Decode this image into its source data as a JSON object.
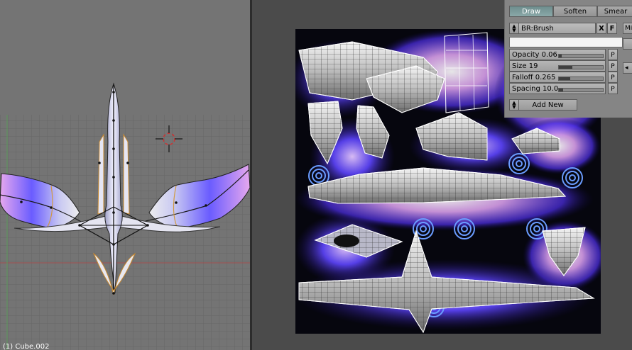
{
  "viewport": {
    "object_name": "(1) Cube.002",
    "colors": {
      "background": "#747474",
      "grid": "#666666",
      "axis_x": "#a05050",
      "axis_y": "#5a9a5a"
    }
  },
  "uv_editor": {
    "colors": {
      "background": "#4b4b4b",
      "texture_bg": "#06060e",
      "paint_blue": "#5a40ff",
      "paint_pink": "#e0a0ff",
      "wire": "#ffffff"
    }
  },
  "paint_panel": {
    "modes": [
      "Draw",
      "Soften",
      "Smear"
    ],
    "active_mode": "Draw",
    "brush_name": "BR:Brush",
    "brush_x_label": "X",
    "brush_f_label": "F",
    "brush_name_value": "",
    "sliders": [
      {
        "label": "Opacity 0.06",
        "value": 0.06,
        "p_label": "P"
      },
      {
        "label": "Size 19",
        "value": 0.3,
        "p_label": "P"
      },
      {
        "label": "Falloff 0.265",
        "value": 0.265,
        "p_label": "P"
      },
      {
        "label": "Spacing 10.0",
        "value": 0.1,
        "p_label": "P"
      }
    ],
    "add_new_label": "Add New",
    "edge_label": "Mi",
    "colors": {
      "panel": "#858585",
      "active_tab": "#7a9a9a"
    }
  }
}
